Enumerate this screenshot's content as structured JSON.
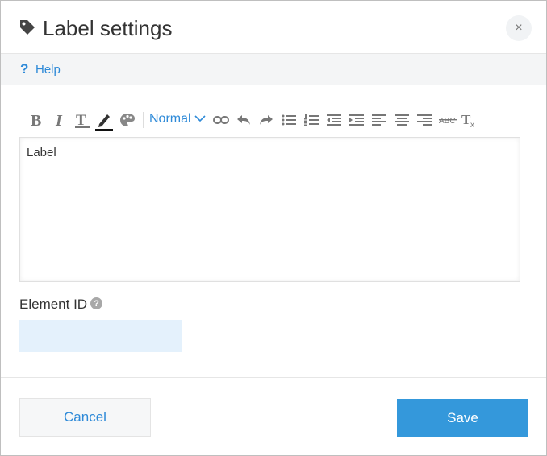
{
  "dialog": {
    "title": "Label settings",
    "close_glyph": "×",
    "icon": "tag-icon"
  },
  "help": {
    "glyph": "?",
    "label": "Help"
  },
  "toolbar": {
    "format_label": "Normal",
    "buttons": [
      "bold-icon",
      "italic-icon",
      "text-color-icon",
      "highlight-pen-icon",
      "palette-icon",
      "link-icon",
      "undo-icon",
      "redo-icon",
      "bullet-list-icon",
      "numbered-list-icon",
      "outdent-icon",
      "indent-icon",
      "align-left-icon",
      "align-center-icon",
      "align-right-icon",
      "strikethrough-icon",
      "clear-format-icon"
    ]
  },
  "editor": {
    "content": "Label"
  },
  "element_id": {
    "label": "Element ID",
    "info_glyph": "?",
    "value": ""
  },
  "footer": {
    "cancel_label": "Cancel",
    "save_label": "Save"
  },
  "colors": {
    "accent": "#2e8ad8",
    "save_button": "#3498db",
    "input_bg": "#e4f1fc"
  }
}
